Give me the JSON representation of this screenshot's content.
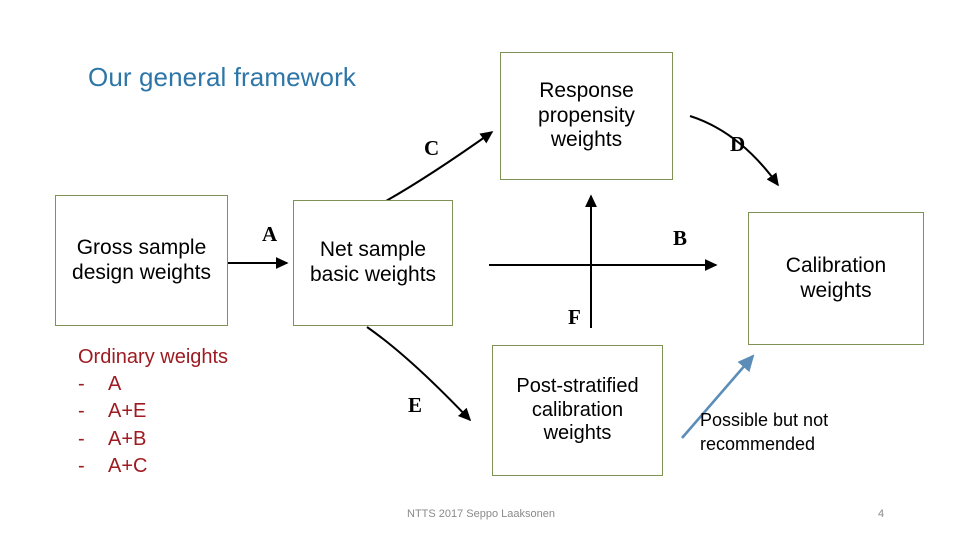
{
  "slide": {
    "title": "Our general framework",
    "title_color": "#2e76a8",
    "background": "#ffffff"
  },
  "diagram": {
    "box_border_color": "#7f9255",
    "nodes": [
      {
        "id": "gross",
        "label": "Gross sample design weights"
      },
      {
        "id": "net",
        "label": "Net sample basic weights"
      },
      {
        "id": "response",
        "label": "Response propensity weights"
      },
      {
        "id": "calib",
        "label": "Calibration weights"
      },
      {
        "id": "post",
        "label": "Post-stratified calibration weights"
      }
    ],
    "edges": [
      {
        "id": "a",
        "label": "A",
        "from": "gross",
        "to": "net",
        "style": "straight-right"
      },
      {
        "id": "c",
        "label": "C",
        "from": "net",
        "to": "response",
        "style": "curved-up-right"
      },
      {
        "id": "d",
        "label": "D",
        "from": "response",
        "to": "calib",
        "style": "curved-down-right"
      },
      {
        "id": "b",
        "label": "B",
        "from": "net",
        "to": "calib",
        "style": "straight-right"
      },
      {
        "id": "e",
        "label": "E",
        "from": "net",
        "to": "post",
        "style": "curved-down-right"
      },
      {
        "id": "f",
        "label": "F",
        "from": "post",
        "to": "response",
        "style": "straight-up"
      }
    ]
  },
  "ordinary_weights": {
    "heading": "Ordinary weights",
    "color": "#9e1b21",
    "dash": "-",
    "items": [
      "A",
      "A+E",
      "A+B",
      "A+C"
    ]
  },
  "note": {
    "line1": "Possible but not",
    "line2": "recommended",
    "arrow_color": "#5b8db8"
  },
  "footer": {
    "text": "NTTS 2017 Seppo Laaksonen",
    "page": "4"
  }
}
